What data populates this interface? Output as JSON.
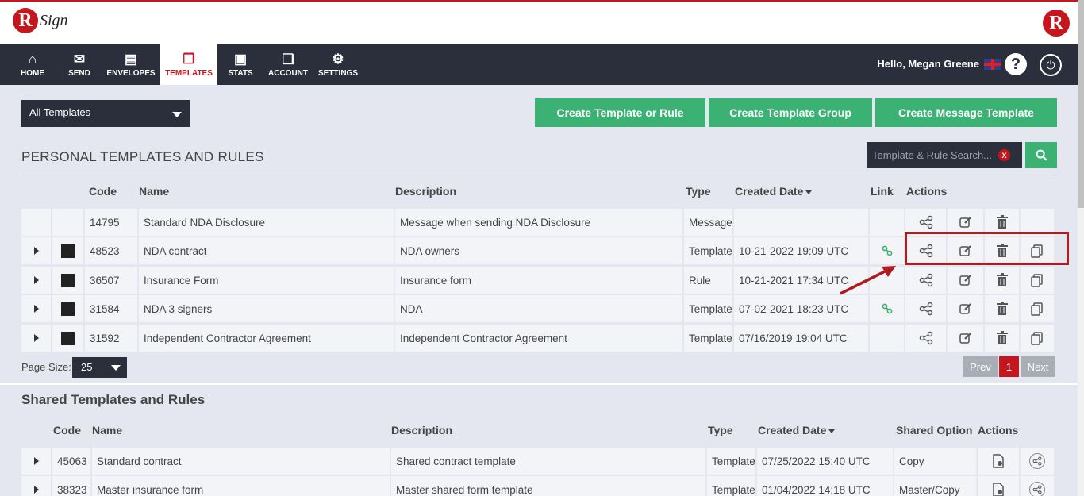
{
  "header": {
    "logo_r": "R",
    "logo_text": "Sign",
    "logo_right": "R"
  },
  "nav": {
    "items": [
      {
        "label": "HOME",
        "icon": "home-icon",
        "glyph": "⌂"
      },
      {
        "label": "SEND",
        "icon": "envelope-icon",
        "glyph": "✉"
      },
      {
        "label": "ENVELOPES",
        "icon": "inbox-icon",
        "glyph": "▤"
      },
      {
        "label": "TEMPLATES",
        "icon": "templates-icon",
        "glyph": "❐"
      },
      {
        "label": "STATS",
        "icon": "briefcase-icon",
        "glyph": "▣"
      },
      {
        "label": "ACCOUNT",
        "icon": "copy-icon",
        "glyph": "❏"
      },
      {
        "label": "SETTINGS",
        "icon": "gear-icon",
        "glyph": "⚙"
      }
    ],
    "greeting": "Hello, Megan Greene",
    "help": "?",
    "power": "⏻"
  },
  "toolbar": {
    "filter_value": "All Templates",
    "buttons": [
      "Create Template or Rule",
      "Create Template Group",
      "Create Message Template"
    ]
  },
  "personal": {
    "title": "PERSONAL TEMPLATES AND RULES",
    "search_placeholder": "Template & Rule Search...",
    "search_clear": "X",
    "columns": {
      "code": "Code",
      "name": "Name",
      "description": "Description",
      "type": "Type",
      "created": "Created Date",
      "link": "Link",
      "actions": "Actions"
    },
    "rows": [
      {
        "code": "14795",
        "name": "Standard NDA Disclosure",
        "description": "Message when sending NDA Disclosure",
        "type": "Message",
        "created": "",
        "link": false
      },
      {
        "code": "48523",
        "name": "NDA contract",
        "description": "NDA owners",
        "type": "Template",
        "created": "10-21-2022 19:09 UTC",
        "link": true
      },
      {
        "code": "36507",
        "name": "Insurance Form",
        "description": "Insurance form",
        "type": "Rule",
        "created": "10-21-2021 17:34 UTC",
        "link": false
      },
      {
        "code": "31584",
        "name": "NDA 3 signers",
        "description": "NDA",
        "type": "Template",
        "created": "07-02-2021 18:23 UTC",
        "link": true
      },
      {
        "code": "31592",
        "name": "Independent Contractor Agreement",
        "description": "Independent Contractor Agreement",
        "type": "Template",
        "created": "07/16/2019 19:04 UTC",
        "link": false
      }
    ],
    "page_size_label": "Page Size:",
    "page_size": "25",
    "pagination": {
      "prev": "Prev",
      "current": "1",
      "next": "Next"
    }
  },
  "shared": {
    "title": "Shared Templates and Rules",
    "columns": {
      "code": "Code",
      "name": "Name",
      "description": "Description",
      "type": "Type",
      "created": "Created Date",
      "shared_option": "Shared Option",
      "actions": "Actions"
    },
    "rows": [
      {
        "code": "45063",
        "name": "Standard contract",
        "description": "Shared contract template",
        "type": "Template",
        "created": "07/25/2022 15:40 UTC",
        "shared_option": "Copy"
      },
      {
        "code": "38323",
        "name": "Master insurance form",
        "description": "Master shared form template",
        "type": "Template",
        "created": "01/04/2022 14:18 UTC",
        "shared_option": "Master/Copy"
      }
    ]
  },
  "colors": {
    "accent_red": "#c4161c",
    "green": "#3bb273",
    "dark": "#2a2f3b"
  }
}
